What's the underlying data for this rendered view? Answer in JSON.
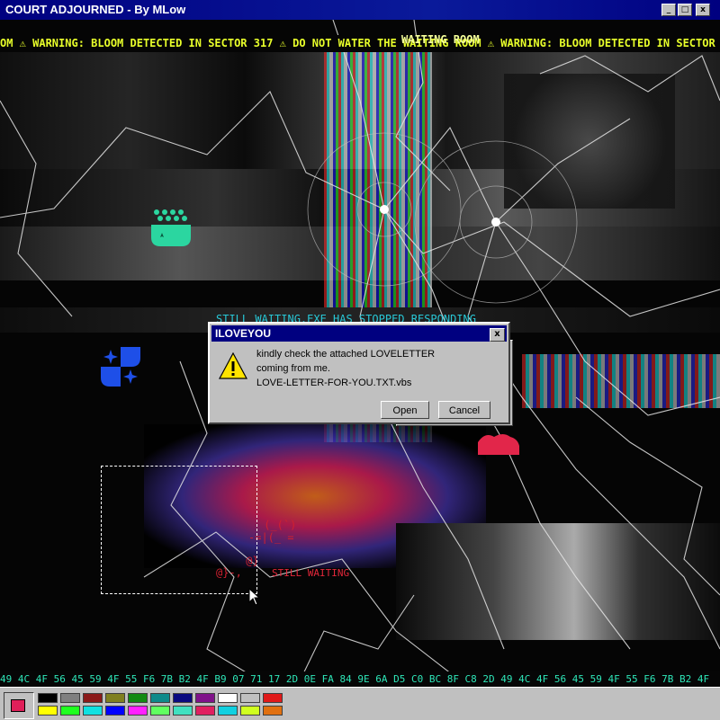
{
  "window": {
    "title": "COURT ADJOURNED - By MLow",
    "controls": {
      "minimize": "_",
      "maximize": "□",
      "close": "x"
    }
  },
  "ticker": {
    "text": "OM ⚠ WARNING: BLOOM DETECTED IN SECTOR 317 ⚠ DO NOT WATER THE WAITING ROOM ⚠ WARNING: BLOOM DETECTED IN SECTOR",
    "ghost_text": "WAITING ROOM"
  },
  "overlay": {
    "status_text": "STILL WAITING.EXE HAS STOPPED RESPONDING",
    "red_text": "STILL WAITING",
    "ascii_art": [
      " (_(`)",
      "-=|(_ =",
      " @}   ",
      "@}-,  "
    ]
  },
  "dialog": {
    "title": "ILOVEYOU",
    "close_label": "x",
    "message_lines": [
      "kindly check the attached LOVELETTER",
      "coming from me.",
      "LOVE-LETTER-FOR-YOU.TXT.vbs"
    ],
    "open_label": "Open",
    "cancel_label": "Cancel",
    "icon": "warning-icon"
  },
  "hex_dump": "49 4C 4F 56 45 59 4F 55 F6 7B B2 4F B9 07 71 17 2D 0E FA 84 9E 6A D5 C0 BC 8F C8 2D 49 4C 4F 56 45 59 4F 55 F6 7B B2 4F",
  "palette": {
    "current_color": "#e0205a",
    "swatches": [
      "#000000",
      "#808080",
      "#8b1a1a",
      "#808020",
      "#138a13",
      "#0f8a8a",
      "#0a0a80",
      "#80138a",
      "#ffffff",
      "#c0c0c0",
      "#e01a1a",
      "#ffff00",
      "#20ff20",
      "#10e0e0",
      "#0000ff",
      "#ff20ff",
      "#60ff60",
      "#40e0c0",
      "#e02060",
      "#10d0e0",
      "#d0ff20",
      "#e07010"
    ]
  },
  "icons": {
    "teal_blob": "teal-blob-icon",
    "blue_sparkle": "blue-sparkle-icon",
    "red_blob": "red-blob-icon",
    "cursor": "mouse-cursor-icon"
  },
  "colors": {
    "ticker": "#e8ff2a",
    "hex": "#2ee6b8",
    "title_bar": "#000080"
  }
}
